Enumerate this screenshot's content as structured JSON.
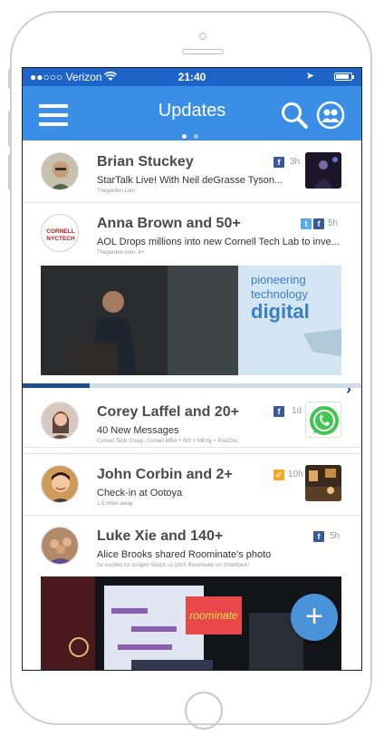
{
  "status": {
    "carrier": "●●○○○ Verizon",
    "time": "21:40",
    "location_glyph": "➤"
  },
  "nav": {
    "title": "Updates"
  },
  "feed": [
    {
      "name": "Brian Stuckey",
      "message": "StarTalk Live! With Neil deGrasse Tyson...",
      "subtext": "Thegarden.com",
      "age": "3h",
      "sources": [
        "facebook"
      ]
    },
    {
      "name": "Anna Brown and 50+",
      "message": "AOL Drops millions into new Cornell Tech Lab to inve...",
      "subtext": "Thegarden.com, 4+",
      "age": "5h",
      "sources": [
        "twitter",
        "facebook"
      ],
      "avatar_text": "CORNELL NYCTECH",
      "image_text": "Cornell Tech pioneering technology digital"
    },
    {
      "name": "Corey Laffel and 20+",
      "message": "40 New Messages",
      "subtext": "Cornell Tech Group, Cornell MBA + MS + MEng + PostDoc",
      "age": "1d",
      "sources": [
        "facebook"
      ]
    },
    {
      "name": "John Corbin and 2+",
      "message": "Check-in at Ootoya",
      "subtext": "1.5 miles away",
      "age": "10h",
      "sources": [
        "foursquare"
      ]
    },
    {
      "name": "Luke Xie and 140+",
      "message": "Alice Brooks shared Roominate's photo",
      "subtext": "So excited for tonight! Watch us pitch Roominate on Sharktank!",
      "age": "5h",
      "sources": [
        "facebook"
      ],
      "image_text": "roominate"
    }
  ],
  "progress": 0.2,
  "fab": {
    "label": "+"
  },
  "colors": {
    "statusbar": "#1e64c8",
    "navbar": "#3a8ee6",
    "facebook": "#3b5998",
    "twitter": "#55acee",
    "whatsapp": "#43c553"
  },
  "icons": [
    "hamburger-icon",
    "search-icon",
    "people-icon",
    "facebook-icon",
    "twitter-icon",
    "foursquare-icon",
    "whatsapp-icon",
    "chevron-right-icon",
    "plus-icon"
  ]
}
